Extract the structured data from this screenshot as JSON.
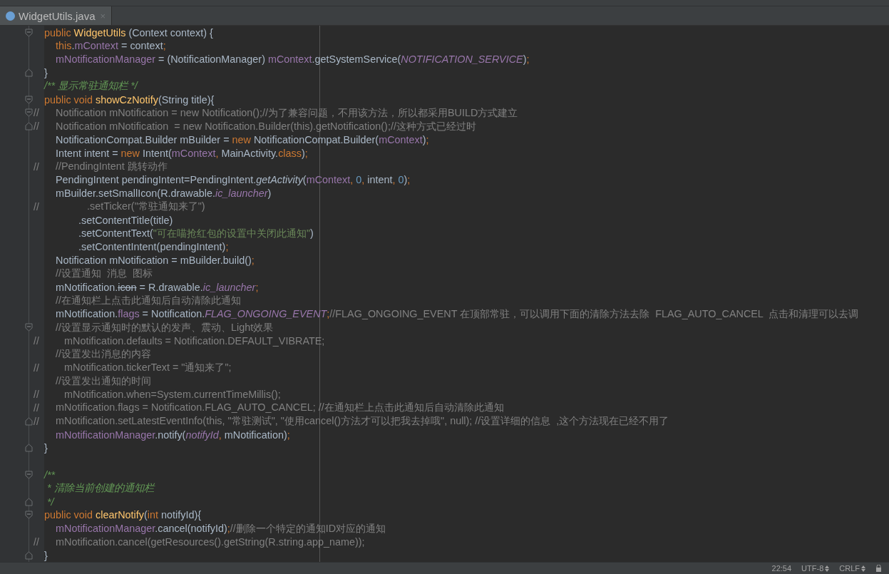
{
  "tabs": [
    {
      "label": "WidgetUtils.java",
      "selected": true,
      "close": "×"
    }
  ],
  "lines": [
    {
      "kind": "block",
      "fold_marker": {
        "kind": "start"
      },
      "tokens": [
        {
          "kind": "kw",
          "text": "public "
        },
        {
          "kind": "decl",
          "text": "WidgetUtils"
        },
        {
          "kind": "plain",
          "text": " (Context context) {"
        }
      ]
    },
    {
      "kind": "body",
      "tokens": [
        {
          "kind": "kw",
          "text": "this"
        },
        {
          "kind": "plain",
          "text": "."
        },
        {
          "kind": "field",
          "text": "mContext"
        },
        {
          "kind": "plain",
          "text": " = context"
        },
        {
          "kind": "kw",
          "text": ";"
        }
      ]
    },
    {
      "kind": "body",
      "tokens": [
        {
          "kind": "field",
          "text": "mNotificationManager"
        },
        {
          "kind": "plain",
          "text": " = (NotificationManager) "
        },
        {
          "kind": "field",
          "text": "mContext"
        },
        {
          "kind": "plain",
          "text": ".getSystemService("
        },
        {
          "kind": "static",
          "text": "NOTIFICATION_SERVICE"
        },
        {
          "kind": "plain",
          "text": ")"
        },
        {
          "kind": "kw",
          "text": ";"
        }
      ]
    },
    {
      "kind": "block",
      "fold_marker": {
        "kind": "end"
      },
      "tokens": [
        {
          "kind": "plain",
          "text": "}"
        }
      ]
    },
    {
      "kind": "block",
      "tokens": [
        {
          "kind": "doc",
          "text": "/** 显示常驻通知栏 */"
        }
      ]
    },
    {
      "kind": "block",
      "fold_marker": {
        "kind": "start"
      },
      "tokens": [
        {
          "kind": "kw",
          "text": "public void "
        },
        {
          "kind": "decl",
          "text": "showCzNotify"
        },
        {
          "kind": "plain",
          "text": "(String title){"
        }
      ]
    },
    {
      "kind": "body",
      "fold_marker": {
        "kind": "start"
      },
      "prefix": "//",
      "tokens": [
        {
          "kind": "comment",
          "text": "Notification mNotification = new Notification();//为了兼容问题，不用该方法，所以都采用BUILD方式建立"
        }
      ]
    },
    {
      "kind": "body",
      "fold_marker": {
        "kind": "end"
      },
      "prefix": "//",
      "tokens": [
        {
          "kind": "comment",
          "text": "Notification mNotification  = new Notification.Builder(this).getNotification();//这种方式已经过时"
        }
      ]
    },
    {
      "kind": "body",
      "tokens": [
        {
          "kind": "plain",
          "text": "NotificationCompat.Builder mBuilder = "
        },
        {
          "kind": "kw",
          "text": "new "
        },
        {
          "kind": "plain",
          "text": "NotificationCompat.Builder("
        },
        {
          "kind": "field",
          "text": "mContext"
        },
        {
          "kind": "plain",
          "text": ")"
        },
        {
          "kind": "kw",
          "text": ";"
        }
      ]
    },
    {
      "kind": "body",
      "tokens": [
        {
          "kind": "plain",
          "text": "Intent intent = "
        },
        {
          "kind": "kw",
          "text": "new "
        },
        {
          "kind": "plain",
          "text": "Intent("
        },
        {
          "kind": "field",
          "text": "mContext"
        },
        {
          "kind": "kw",
          "text": ", "
        },
        {
          "kind": "plain",
          "text": "MainActivity."
        },
        {
          "kind": "kw",
          "text": "class"
        },
        {
          "kind": "plain",
          "text": ")"
        },
        {
          "kind": "kw",
          "text": ";"
        }
      ]
    },
    {
      "kind": "body",
      "prefix": "//",
      "tokens": [
        {
          "kind": "comment",
          "text": "//PendingIntent 跳转动作"
        }
      ]
    },
    {
      "kind": "body",
      "tokens": [
        {
          "kind": "plain",
          "text": "PendingIntent pendingIntent=PendingIntent."
        },
        {
          "kind": "italic",
          "text": "getActivity"
        },
        {
          "kind": "plain",
          "text": "("
        },
        {
          "kind": "field",
          "text": "mContext"
        },
        {
          "kind": "kw",
          "text": ", "
        },
        {
          "kind": "num",
          "text": "0"
        },
        {
          "kind": "kw",
          "text": ", "
        },
        {
          "kind": "plain",
          "text": "intent"
        },
        {
          "kind": "kw",
          "text": ", "
        },
        {
          "kind": "num",
          "text": "0"
        },
        {
          "kind": "plain",
          "text": ")"
        },
        {
          "kind": "kw",
          "text": ";"
        }
      ]
    },
    {
      "kind": "body",
      "tokens": [
        {
          "kind": "plain",
          "text": "mBuilder.setSmallIcon(R.drawable."
        },
        {
          "kind": "static",
          "text": "ic_launcher"
        },
        {
          "kind": "plain",
          "text": ")"
        }
      ]
    },
    {
      "kind": "commented-chain",
      "prefix": "//",
      "tokens": [
        {
          "kind": "comment",
          "text": ".setTicker(\"常驻通知来了\")"
        }
      ]
    },
    {
      "kind": "chain",
      "tokens": [
        {
          "kind": "plain",
          "text": ".setContentTitle(title)"
        }
      ]
    },
    {
      "kind": "chain",
      "tokens": [
        {
          "kind": "plain",
          "text": ".setContentText("
        },
        {
          "kind": "str",
          "text": "\"可在喵抢红包的设置中关闭此通知\""
        },
        {
          "kind": "plain",
          "text": ")"
        }
      ]
    },
    {
      "kind": "chain",
      "tokens": [
        {
          "kind": "plain",
          "text": ".setContentIntent(pendingIntent)"
        },
        {
          "kind": "kw",
          "text": ";"
        }
      ]
    },
    {
      "kind": "body",
      "tokens": [
        {
          "kind": "plain",
          "text": "Notification mNotification = mBuilder.build()"
        },
        {
          "kind": "kw",
          "text": ";"
        }
      ]
    },
    {
      "kind": "body",
      "tokens": [
        {
          "kind": "comment",
          "text": "//设置通知  消息  图标"
        }
      ]
    },
    {
      "kind": "body",
      "tokens": [
        {
          "kind": "plain",
          "text": "mNotification."
        },
        {
          "kind": "deprecated",
          "text": "icon"
        },
        {
          "kind": "plain",
          "text": " = R.drawable."
        },
        {
          "kind": "static",
          "text": "ic_launcher"
        },
        {
          "kind": "kw",
          "text": ";"
        }
      ]
    },
    {
      "kind": "body",
      "tokens": [
        {
          "kind": "comment",
          "text": "//在通知栏上点击此通知后自动清除此通知"
        }
      ]
    },
    {
      "kind": "body",
      "tokens": [
        {
          "kind": "plain",
          "text": "mNotification."
        },
        {
          "kind": "field",
          "text": "flags"
        },
        {
          "kind": "plain",
          "text": " = Notification."
        },
        {
          "kind": "static",
          "text": "FLAG_ONGOING_EVENT"
        },
        {
          "kind": "kw",
          "text": ";"
        },
        {
          "kind": "comment",
          "text": "//FLAG_ONGOING_EVENT 在顶部常驻，可以调用下面的清除方法去除  FLAG_AUTO_CANCEL  点击和清理可以去调"
        }
      ]
    },
    {
      "kind": "body",
      "fold_marker": {
        "kind": "start"
      },
      "tokens": [
        {
          "kind": "comment",
          "text": "//设置显示通知时的默认的发声、震动、Light效果"
        }
      ]
    },
    {
      "kind": "commented-body",
      "prefix": "//",
      "tokens": [
        {
          "kind": "comment",
          "text": "mNotification.defaults = Notification.DEFAULT_VIBRATE;"
        }
      ]
    },
    {
      "kind": "body",
      "tokens": [
        {
          "kind": "comment",
          "text": "//设置发出消息的内容"
        }
      ]
    },
    {
      "kind": "commented-body",
      "prefix": "//",
      "tokens": [
        {
          "kind": "comment",
          "text": "mNotification.tickerText = \"通知来了\";"
        }
      ]
    },
    {
      "kind": "body",
      "tokens": [
        {
          "kind": "comment",
          "text": "//设置发出通知的时间"
        }
      ]
    },
    {
      "kind": "commented-body",
      "prefix": "//",
      "tokens": [
        {
          "kind": "comment",
          "text": "mNotification.when=System.currentTimeMillis();"
        }
      ]
    },
    {
      "kind": "body",
      "prefix": "//",
      "tokens": [
        {
          "kind": "comment",
          "text": "mNotification.flags = Notification.FLAG_AUTO_CANCEL; //在通知栏上点击此通知后自动清除此通知"
        }
      ]
    },
    {
      "kind": "body",
      "fold_marker": {
        "kind": "end"
      },
      "prefix": "//",
      "tokens": [
        {
          "kind": "comment",
          "text": "mNotification.setLatestEventInfo(this, \"常驻测试\", \"使用cancel()方法才可以把我去掉哦\", null); //设置详细的信息  ,这个方法现在已经不用了"
        }
      ]
    },
    {
      "kind": "body",
      "tokens": [
        {
          "kind": "field",
          "text": "mNotificationManager"
        },
        {
          "kind": "plain",
          "text": ".notify("
        },
        {
          "kind": "static",
          "text": "notifyId"
        },
        {
          "kind": "kw",
          "text": ", "
        },
        {
          "kind": "plain",
          "text": "mNotification)"
        },
        {
          "kind": "kw",
          "text": ";"
        }
      ]
    },
    {
      "kind": "block",
      "fold_marker": {
        "kind": "end"
      },
      "tokens": [
        {
          "kind": "plain",
          "text": "}"
        }
      ]
    },
    {
      "kind": "blank"
    },
    {
      "kind": "block",
      "fold_marker": {
        "kind": "start"
      },
      "tokens": [
        {
          "kind": "doc",
          "text": "/**"
        }
      ]
    },
    {
      "kind": "doc",
      "tokens": [
        {
          "kind": "doc",
          "text": "* 清除当前创建的通知栏"
        }
      ]
    },
    {
      "kind": "doc",
      "fold_marker": {
        "kind": "end"
      },
      "tokens": [
        {
          "kind": "doc",
          "text": "*/"
        }
      ]
    },
    {
      "kind": "block",
      "fold_marker": {
        "kind": "start"
      },
      "tokens": [
        {
          "kind": "kw",
          "text": "public void "
        },
        {
          "kind": "decl",
          "text": "clearNotify"
        },
        {
          "kind": "plain",
          "text": "("
        },
        {
          "kind": "kw",
          "text": "int "
        },
        {
          "kind": "plain",
          "text": "notifyId){"
        }
      ]
    },
    {
      "kind": "body",
      "tokens": [
        {
          "kind": "field",
          "text": "mNotificationManager"
        },
        {
          "kind": "plain",
          "text": ".cancel(notifyId)"
        },
        {
          "kind": "kw",
          "text": ";"
        },
        {
          "kind": "comment",
          "text": "//删除一个特定的通知ID对应的通知"
        }
      ]
    },
    {
      "kind": "body",
      "prefix": "//",
      "tokens": [
        {
          "kind": "comment",
          "text": "mNotification.cancel(getResources().getString(R.string.app_name));"
        }
      ]
    },
    {
      "kind": "block",
      "fold_marker": {
        "kind": "end"
      },
      "tokens": [
        {
          "kind": "plain",
          "text": "}"
        }
      ]
    }
  ],
  "status_bar": {
    "position": "22:54",
    "encoding": "UTF-8",
    "line_separator": "CRLF"
  }
}
